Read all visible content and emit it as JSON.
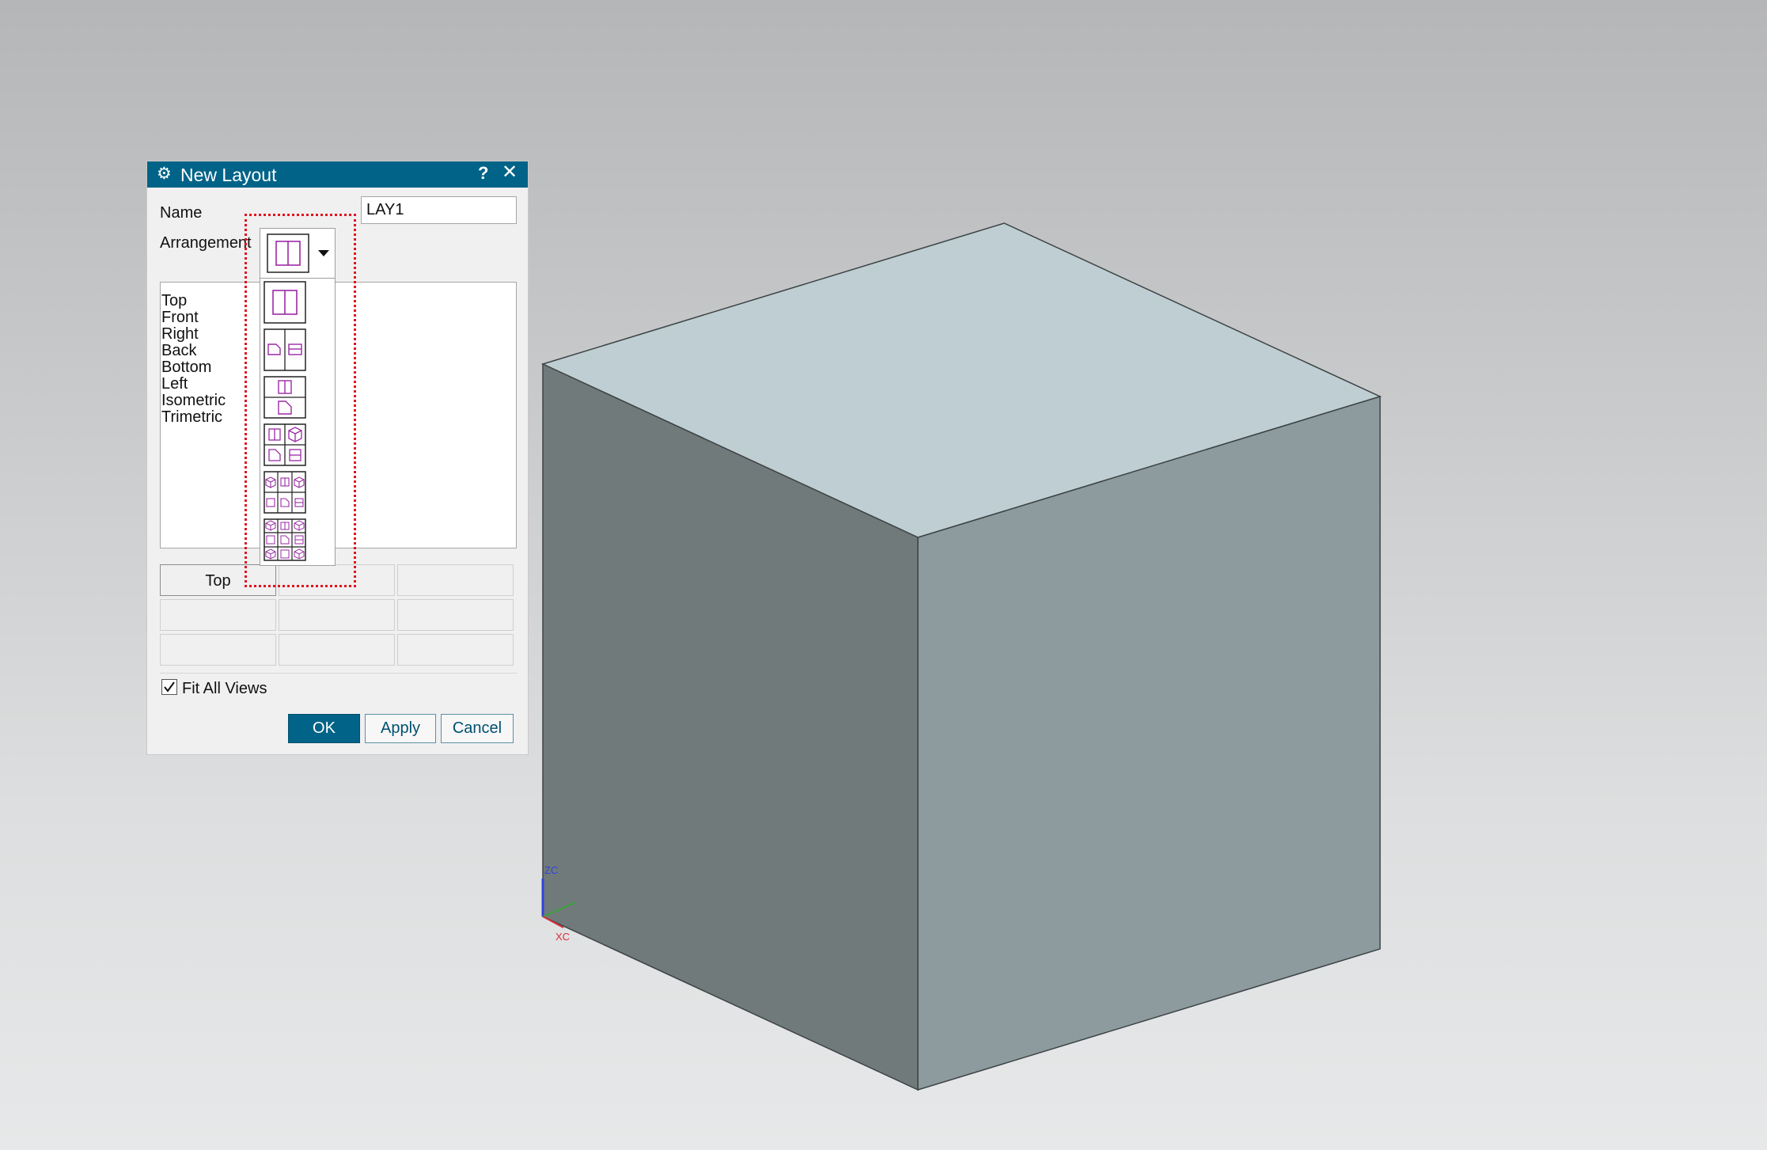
{
  "dialog": {
    "title": "New Layout",
    "title_icon": "gear-icon",
    "help": "?",
    "close": "✕",
    "name_label": "Name",
    "name_value": "LAY1",
    "arrangement_label": "Arrangement",
    "views": [
      "Top",
      "Front",
      "Right",
      "Back",
      "Bottom",
      "Left",
      "Isometric",
      "Trimetric"
    ],
    "grid_cells": [
      "Top",
      "",
      "",
      "",
      "",
      "",
      "",
      "",
      ""
    ],
    "fit_all_views_label": "Fit All Views",
    "fit_all_views_checked": true,
    "ok_label": "OK",
    "apply_label": "Apply",
    "cancel_label": "Cancel"
  },
  "arrangement": {
    "selected": "two-vertical-panes",
    "options": [
      "two-vertical-panes",
      "two-horizontal-views",
      "two-stacked-views",
      "four-views",
      "six-views",
      "nine-views"
    ]
  },
  "viewport": {
    "triad_zc": "ZC",
    "triad_xc": "XC"
  },
  "colors": {
    "titlebar": "#006387",
    "icon_magenta": "#9b2aa6",
    "highlight_red": "#e0141e",
    "cube_top": "#bfced2",
    "cube_left": "#717a7b",
    "cube_right": "#8d9a9e"
  }
}
